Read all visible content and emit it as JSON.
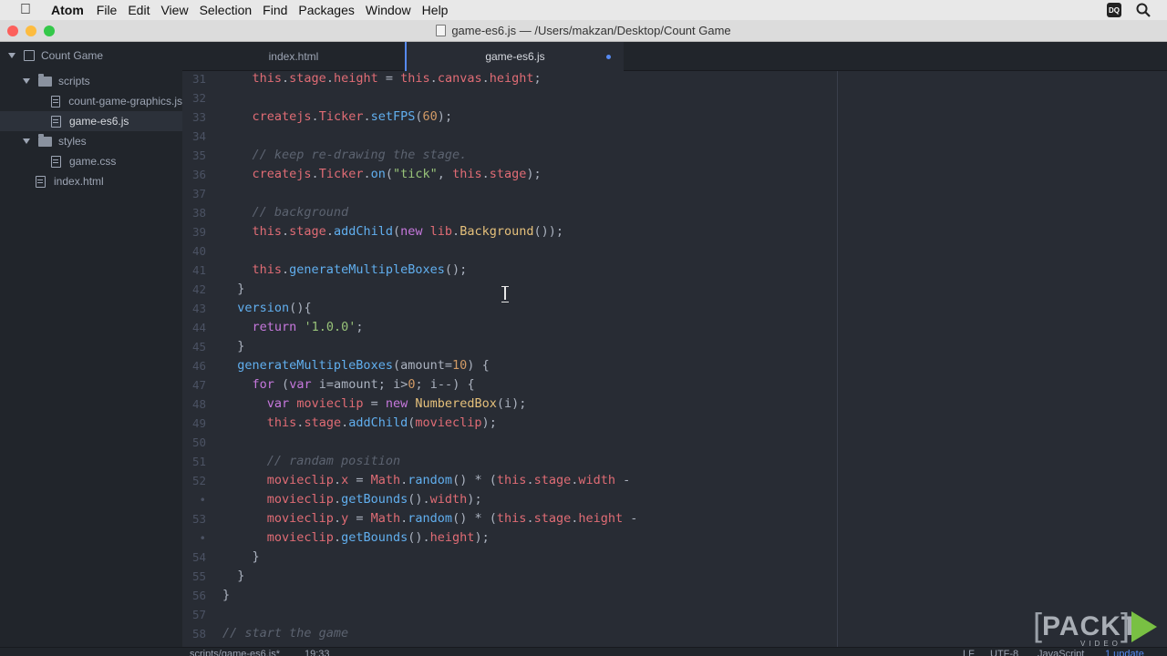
{
  "menubar": {
    "apple_icon": "apple-icon",
    "items": [
      "Atom",
      "File",
      "Edit",
      "View",
      "Selection",
      "Find",
      "Packages",
      "Window",
      "Help"
    ],
    "dq_badge": "DQ"
  },
  "window": {
    "title": "game-es6.js — /Users/makzan/Desktop/Count Game"
  },
  "tree": {
    "root": "Count Game",
    "items": [
      {
        "label": "scripts"
      },
      {
        "label": "count-game-graphics.js"
      },
      {
        "label": "game-es6.js"
      },
      {
        "label": "styles"
      },
      {
        "label": "game.css"
      },
      {
        "label": "index.html"
      }
    ]
  },
  "tabs": [
    {
      "label": "index.html"
    },
    {
      "label": "game-es6.js"
    }
  ],
  "editor": {
    "line_numbers": [
      "31",
      "32",
      "33",
      "34",
      "35",
      "36",
      "37",
      "38",
      "39",
      "40",
      "41",
      "42",
      "43",
      "44",
      "45",
      "46",
      "47",
      "48",
      "49",
      "50",
      "51",
      "52",
      "•",
      "53",
      "•",
      "54",
      "55",
      "56",
      "57",
      "58"
    ],
    "lines": [
      "    this.stage.height = this.canvas.height;",
      "",
      "    createjs.Ticker.setFPS(60);",
      "",
      "    // keep re-drawing the stage.",
      "    createjs.Ticker.on(\"tick\", this.stage);",
      "",
      "    // background",
      "    this.stage.addChild(new lib.Background());",
      "",
      "    this.generateMultipleBoxes();",
      "  }",
      "  version(){",
      "    return '1.0.0';",
      "  }",
      "  generateMultipleBoxes(amount=10) {",
      "    for (var i=amount; i>0; i--) {",
      "      var movieclip = new NumberedBox(i);",
      "      this.stage.addChild(movieclip);",
      "",
      "      // randam position",
      "      movieclip.x = Math.random() * (this.stage.width -",
      "      movieclip.getBounds().width);",
      "      movieclip.y = Math.random() * (this.stage.height -",
      "      movieclip.getBounds().height);",
      "    }",
      "  }",
      "}",
      "",
      "// start the game"
    ]
  },
  "statusbar": {
    "path": "scripts/game-es6.js*",
    "cursor": "19:33",
    "line_ending": "LF",
    "encoding": "UTF-8",
    "grammar": "JavaScript",
    "updates": "1 update"
  },
  "watermark": {
    "word": "PACKT",
    "sub": "VIDEO"
  },
  "colors": {
    "accent": "#568af2",
    "background": "#282c34",
    "sidebar": "#21252b"
  }
}
